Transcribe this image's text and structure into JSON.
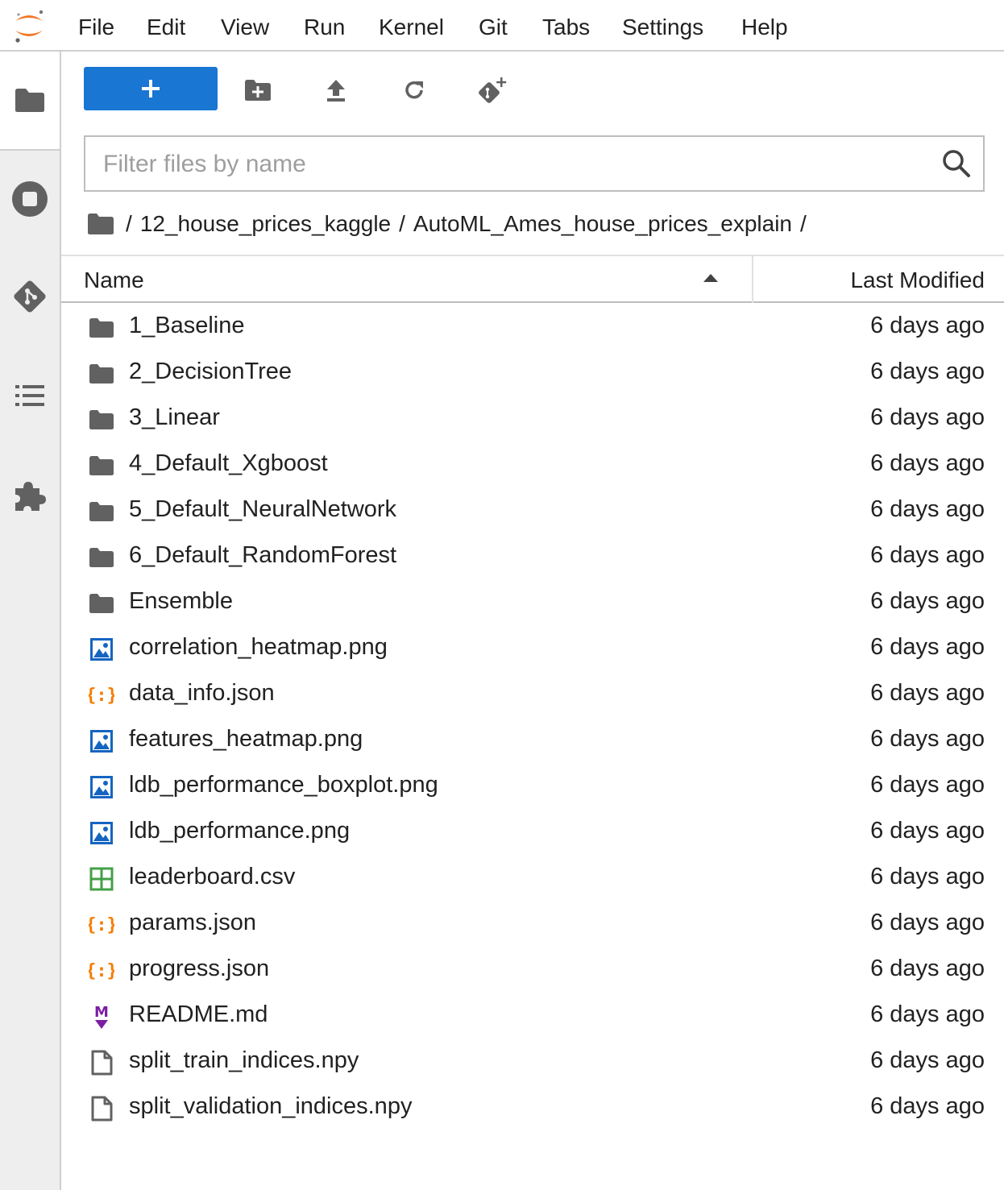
{
  "menu": [
    "File",
    "Edit",
    "View",
    "Run",
    "Kernel",
    "Git",
    "Tabs",
    "Settings",
    "Help"
  ],
  "toolbar": {
    "new_label": "+"
  },
  "filter": {
    "placeholder": "Filter files by name",
    "value": ""
  },
  "breadcrumb": [
    "/",
    "12_house_prices_kaggle",
    "/",
    "AutoML_Ames_house_prices_explain",
    "/"
  ],
  "columns": {
    "name": "Name",
    "modified": "Last Modified"
  },
  "files": [
    {
      "name": "1_Baseline",
      "modified": "6 days ago",
      "icon": "folder-icon"
    },
    {
      "name": "2_DecisionTree",
      "modified": "6 days ago",
      "icon": "folder-icon"
    },
    {
      "name": "3_Linear",
      "modified": "6 days ago",
      "icon": "folder-icon"
    },
    {
      "name": "4_Default_Xgboost",
      "modified": "6 days ago",
      "icon": "folder-icon"
    },
    {
      "name": "5_Default_NeuralNetwork",
      "modified": "6 days ago",
      "icon": "folder-icon"
    },
    {
      "name": "6_Default_RandomForest",
      "modified": "6 days ago",
      "icon": "folder-icon"
    },
    {
      "name": "Ensemble",
      "modified": "6 days ago",
      "icon": "folder-icon"
    },
    {
      "name": "correlation_heatmap.png",
      "modified": "6 days ago",
      "icon": "image-file-icon"
    },
    {
      "name": "data_info.json",
      "modified": "6 days ago",
      "icon": "json-file-icon"
    },
    {
      "name": "features_heatmap.png",
      "modified": "6 days ago",
      "icon": "image-file-icon"
    },
    {
      "name": "ldb_performance_boxplot.png",
      "modified": "6 days ago",
      "icon": "image-file-icon"
    },
    {
      "name": "ldb_performance.png",
      "modified": "6 days ago",
      "icon": "image-file-icon"
    },
    {
      "name": "leaderboard.csv",
      "modified": "6 days ago",
      "icon": "spreadsheet-file-icon"
    },
    {
      "name": "params.json",
      "modified": "6 days ago",
      "icon": "json-file-icon"
    },
    {
      "name": "progress.json",
      "modified": "6 days ago",
      "icon": "json-file-icon"
    },
    {
      "name": "README.md",
      "modified": "6 days ago",
      "icon": "markdown-file-icon"
    },
    {
      "name": "split_train_indices.npy",
      "modified": "6 days ago",
      "icon": "generic-file-icon"
    },
    {
      "name": "split_validation_indices.npy",
      "modified": "6 days ago",
      "icon": "generic-file-icon"
    }
  ],
  "colors": {
    "accent": "#1976d2",
    "logo_orange": "#f37726",
    "image_icon": "#1565c0",
    "json_icon": "#f57c00",
    "csv_icon": "#43a047",
    "markdown_icon": "#7b1fa2",
    "icon_gray": "#616161"
  }
}
